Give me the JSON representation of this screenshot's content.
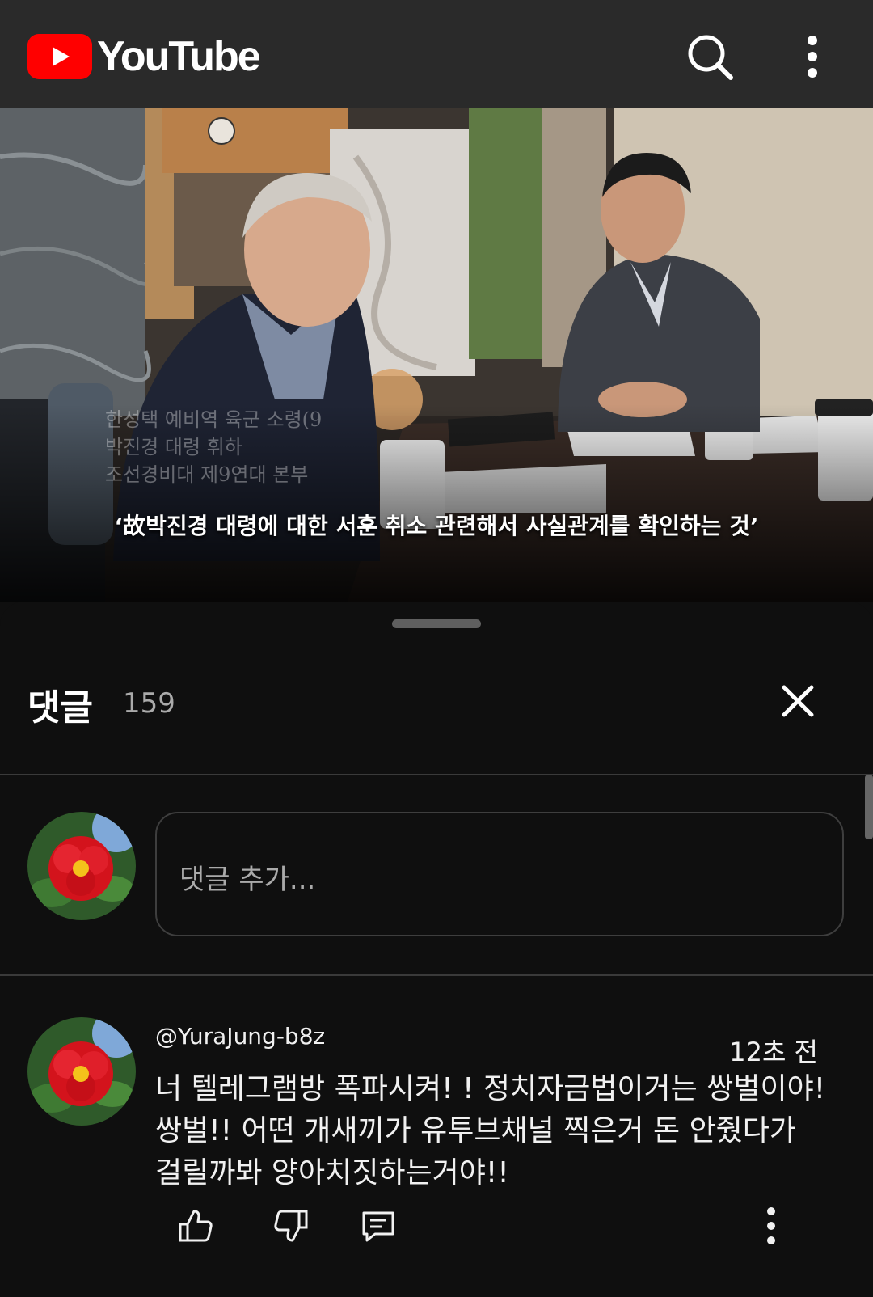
{
  "app": {
    "name": "YouTube"
  },
  "header": {
    "search_icon": "search-icon",
    "more_icon": "more-vert-icon"
  },
  "video": {
    "subtitle": "‘故박진경 대령에 대한 서훈 취소 관련해서 사실관계를 확인하는 것’",
    "caption_lines": [
      "한성택 예비역 육군 소령(9",
      "박진경 대령 휘하",
      "조선경비대 제9연대 본부"
    ]
  },
  "comments": {
    "title": "댓글",
    "count": "159",
    "add_placeholder": "댓글 추가...",
    "items": [
      {
        "author": "@YuraJung-b8z",
        "time": "12초 전",
        "text": "너 텔레그램방 폭파시켜! ! 정치자금법이거는 쌍벌이야!쌍벌!! 어떤 개새끼가 유투브채널 찍은거 돈 안줬다가 걸릴까봐 양아치짓하는거야!!"
      }
    ]
  },
  "colors": {
    "brand": "#ff0000",
    "background": "#0f0f0f",
    "header": "#2a2a2a",
    "muted": "#aaaaaa"
  }
}
